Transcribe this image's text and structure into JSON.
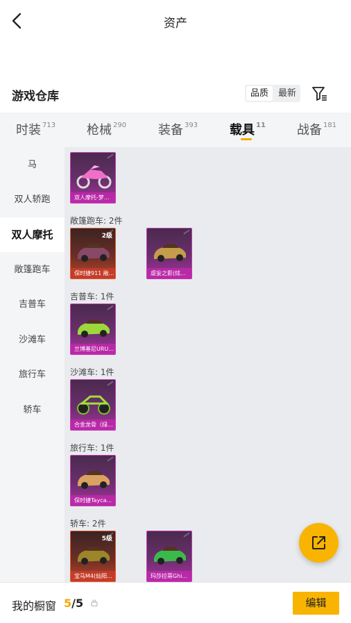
{
  "header": {
    "title": "资产"
  },
  "warehouse": {
    "title": "游戏仓库",
    "sort_options": [
      "品质",
      "最新"
    ]
  },
  "tabs": [
    {
      "label": "时装",
      "count": "713"
    },
    {
      "label": "枪械",
      "count": "290"
    },
    {
      "label": "装备",
      "count": "393"
    },
    {
      "label": "载具",
      "count": "11"
    },
    {
      "label": "战备",
      "count": "181"
    }
  ],
  "sidebar": {
    "items": [
      "马",
      "双人轿跑",
      "双人摩托",
      "敞篷跑车",
      "吉普车",
      "沙滩车",
      "旅行车",
      "轿车"
    ]
  },
  "groups": [
    {
      "label": "",
      "cards": [
        {
          "name": "双人摩托-梦...",
          "level": "",
          "rarity": "purple",
          "art": "motorbike"
        }
      ]
    },
    {
      "label": "敞篷跑车: 2件",
      "cards": [
        {
          "name": "保时捷911 敞...",
          "level": "2级",
          "rarity": "orange",
          "art": "car"
        },
        {
          "name": "虐妄之影(炫...",
          "level": "",
          "rarity": "purple",
          "art": "car"
        }
      ]
    },
    {
      "label": "吉普车: 1件",
      "cards": [
        {
          "name": "兰博基尼URU...",
          "level": "",
          "rarity": "purple",
          "art": "car"
        }
      ]
    },
    {
      "label": "沙滩车: 1件",
      "cards": [
        {
          "name": "合金龙骨（绿...",
          "level": "",
          "rarity": "purple",
          "art": "buggy"
        }
      ]
    },
    {
      "label": "旅行车: 1件",
      "cards": [
        {
          "name": "保时捷Tayca...",
          "level": "",
          "rarity": "purple",
          "art": "car"
        }
      ]
    },
    {
      "label": "轿车: 2件",
      "cards": [
        {
          "name": "宝马M4(灿阳...",
          "level": "5级",
          "rarity": "orange",
          "art": "car"
        },
        {
          "name": "玛莎拉蒂Ghi...",
          "level": "",
          "rarity": "purple",
          "art": "car"
        }
      ]
    }
  ],
  "bottom": {
    "label": "我的橱窗",
    "current": "5",
    "separator": "/",
    "total": "5",
    "edit_label": "编辑"
  },
  "colors": {
    "accent": "#f8b400",
    "purple_rarity": "#c43bb8",
    "orange_rarity": "#e05a34"
  }
}
